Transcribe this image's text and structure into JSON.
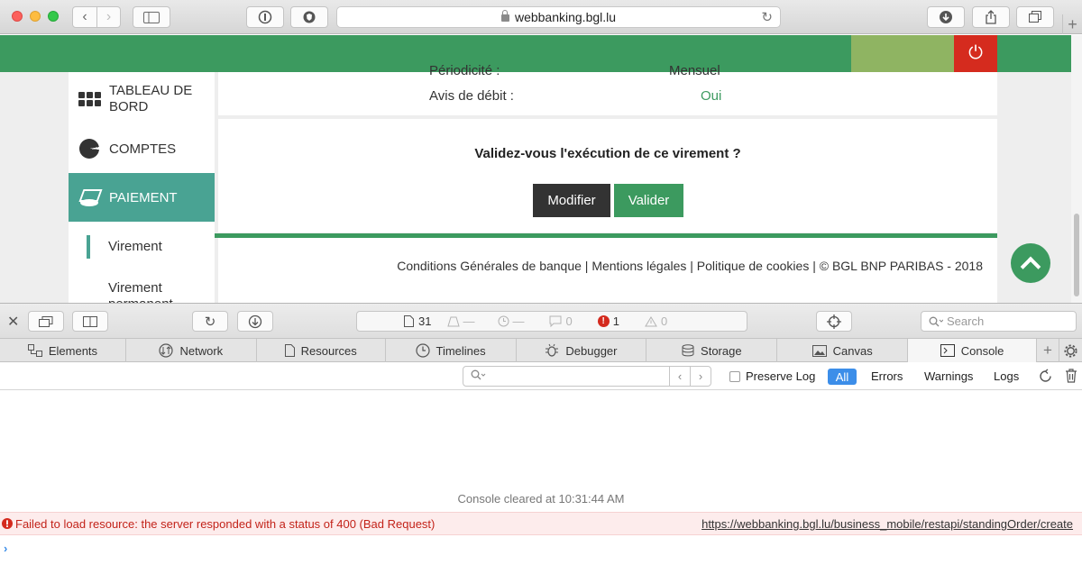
{
  "browser": {
    "url": "webbanking.bgl.lu",
    "reload_glyph": "↻",
    "back_glyph": "‹",
    "forward_glyph": "›",
    "newtab_glyph": "+",
    "icons": [
      "back-icon",
      "forward-icon",
      "sidebar-icon",
      "info-icon",
      "shield-icon",
      "lock-icon",
      "reload-icon",
      "download-icon",
      "share-icon",
      "tabs-icon"
    ]
  },
  "bank": {
    "colors": {
      "green": "#3c9a5f",
      "teal": "#49a393",
      "light_green": "#8fb462",
      "red": "#d52b1e",
      "dark_button": "#333333"
    },
    "power_glyph": "⏻",
    "sidebar": {
      "items": [
        {
          "label": "TABLEAU DE BORD",
          "icon": "dashboard-grid-icon"
        },
        {
          "label": "COMPTES",
          "icon": "pie-chart-icon"
        },
        {
          "label": "PAIEMENT",
          "icon": "payment-icon",
          "active": true
        }
      ],
      "sub_items": [
        "Virement",
        "Virement permanent"
      ]
    },
    "details": {
      "periodicite_label": "Périodicité :",
      "periodicite_value": "Mensuel",
      "avis_label": "Avis de débit :",
      "avis_value": "Oui"
    },
    "confirm": {
      "question": "Validez-vous l'exécution de ce virement ?",
      "modify_label": "Modifier",
      "validate_label": "Valider"
    },
    "footer": {
      "text": "Conditions Générales de banque | Mentions légales | Politique de cookies | © BGL BNP PARIBAS - 2018"
    }
  },
  "inspector": {
    "status": {
      "resources": "31",
      "pending": "—",
      "time": "—",
      "logs": "0",
      "errors": "1",
      "warnings": "0"
    },
    "search_placeholder": "Search",
    "tabs": [
      {
        "label": "Elements",
        "icon": "elements-icon"
      },
      {
        "label": "Network",
        "icon": "network-icon"
      },
      {
        "label": "Resources",
        "icon": "resources-icon"
      },
      {
        "label": "Timelines",
        "icon": "timelines-icon"
      },
      {
        "label": "Debugger",
        "icon": "debugger-icon"
      },
      {
        "label": "Storage",
        "icon": "storage-icon"
      },
      {
        "label": "Canvas",
        "icon": "canvas-icon"
      },
      {
        "label": "Console",
        "icon": "console-icon",
        "selected": true
      }
    ],
    "filter": {
      "preserve_log": "Preserve Log",
      "all": "All",
      "errors": "Errors",
      "warnings": "Warnings",
      "logs": "Logs"
    },
    "console": {
      "cleared": "Console cleared at 10:31:44 AM",
      "error_message": "Failed to load resource: the server responded with a status of 400 (Bad Request)",
      "error_url": "https://webbanking.bgl.lu/business_mobile/restapi/standingOrder/create",
      "prompt_glyph": "›"
    }
  }
}
